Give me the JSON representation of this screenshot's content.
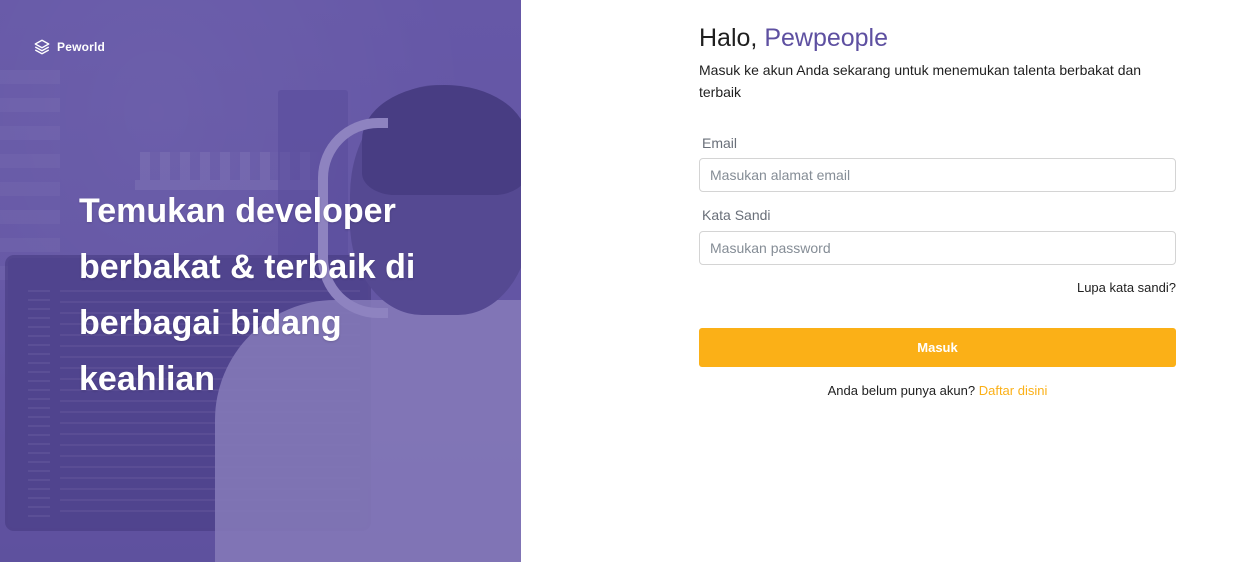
{
  "brand": {
    "name": "Peworld",
    "icon": "layers-icon"
  },
  "hero": {
    "headline_lines": [
      "Temukan developer",
      "berbakat & terbaik di",
      "berbagai bidang",
      "keahlian"
    ],
    "overlay_color": "#5e50a1"
  },
  "login": {
    "greeting_prefix": "Halo, ",
    "greeting_name": "Pewpeople",
    "subtitle": "Masuk ke akun Anda sekarang untuk menemukan talenta berbakat dan terbaik",
    "email": {
      "label": "Email",
      "placeholder": "Masukan alamat email",
      "value": ""
    },
    "password": {
      "label": "Kata Sandi",
      "placeholder": "Masukan password",
      "value": ""
    },
    "forgot_label": "Lupa kata sandi?",
    "submit_label": "Masuk",
    "register_prompt": "Anda belum punya akun?",
    "register_link": "Daftar disini"
  },
  "colors": {
    "primary": "#5e50a1",
    "accent": "#fbb017"
  }
}
